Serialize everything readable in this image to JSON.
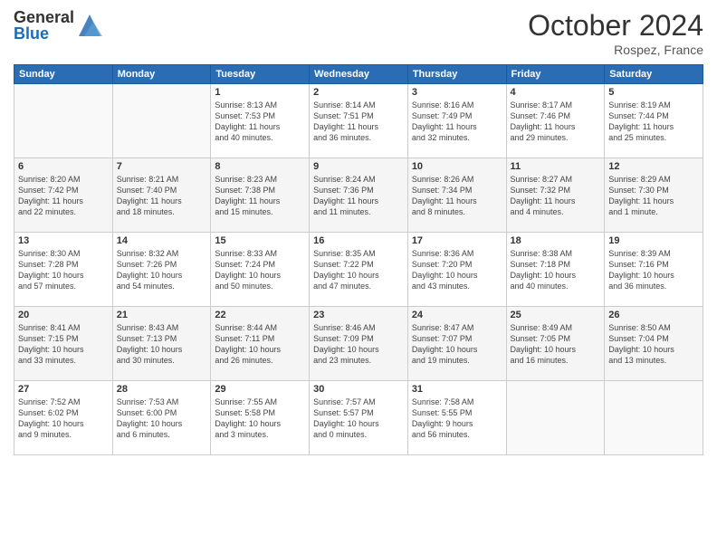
{
  "logo": {
    "general": "General",
    "blue": "Blue"
  },
  "title": "October 2024",
  "location": "Rospez, France",
  "days_header": [
    "Sunday",
    "Monday",
    "Tuesday",
    "Wednesday",
    "Thursday",
    "Friday",
    "Saturday"
  ],
  "weeks": [
    [
      {
        "day": "",
        "info": ""
      },
      {
        "day": "",
        "info": ""
      },
      {
        "day": "1",
        "info": "Sunrise: 8:13 AM\nSunset: 7:53 PM\nDaylight: 11 hours\nand 40 minutes."
      },
      {
        "day": "2",
        "info": "Sunrise: 8:14 AM\nSunset: 7:51 PM\nDaylight: 11 hours\nand 36 minutes."
      },
      {
        "day": "3",
        "info": "Sunrise: 8:16 AM\nSunset: 7:49 PM\nDaylight: 11 hours\nand 32 minutes."
      },
      {
        "day": "4",
        "info": "Sunrise: 8:17 AM\nSunset: 7:46 PM\nDaylight: 11 hours\nand 29 minutes."
      },
      {
        "day": "5",
        "info": "Sunrise: 8:19 AM\nSunset: 7:44 PM\nDaylight: 11 hours\nand 25 minutes."
      }
    ],
    [
      {
        "day": "6",
        "info": "Sunrise: 8:20 AM\nSunset: 7:42 PM\nDaylight: 11 hours\nand 22 minutes."
      },
      {
        "day": "7",
        "info": "Sunrise: 8:21 AM\nSunset: 7:40 PM\nDaylight: 11 hours\nand 18 minutes."
      },
      {
        "day": "8",
        "info": "Sunrise: 8:23 AM\nSunset: 7:38 PM\nDaylight: 11 hours\nand 15 minutes."
      },
      {
        "day": "9",
        "info": "Sunrise: 8:24 AM\nSunset: 7:36 PM\nDaylight: 11 hours\nand 11 minutes."
      },
      {
        "day": "10",
        "info": "Sunrise: 8:26 AM\nSunset: 7:34 PM\nDaylight: 11 hours\nand 8 minutes."
      },
      {
        "day": "11",
        "info": "Sunrise: 8:27 AM\nSunset: 7:32 PM\nDaylight: 11 hours\nand 4 minutes."
      },
      {
        "day": "12",
        "info": "Sunrise: 8:29 AM\nSunset: 7:30 PM\nDaylight: 11 hours\nand 1 minute."
      }
    ],
    [
      {
        "day": "13",
        "info": "Sunrise: 8:30 AM\nSunset: 7:28 PM\nDaylight: 10 hours\nand 57 minutes."
      },
      {
        "day": "14",
        "info": "Sunrise: 8:32 AM\nSunset: 7:26 PM\nDaylight: 10 hours\nand 54 minutes."
      },
      {
        "day": "15",
        "info": "Sunrise: 8:33 AM\nSunset: 7:24 PM\nDaylight: 10 hours\nand 50 minutes."
      },
      {
        "day": "16",
        "info": "Sunrise: 8:35 AM\nSunset: 7:22 PM\nDaylight: 10 hours\nand 47 minutes."
      },
      {
        "day": "17",
        "info": "Sunrise: 8:36 AM\nSunset: 7:20 PM\nDaylight: 10 hours\nand 43 minutes."
      },
      {
        "day": "18",
        "info": "Sunrise: 8:38 AM\nSunset: 7:18 PM\nDaylight: 10 hours\nand 40 minutes."
      },
      {
        "day": "19",
        "info": "Sunrise: 8:39 AM\nSunset: 7:16 PM\nDaylight: 10 hours\nand 36 minutes."
      }
    ],
    [
      {
        "day": "20",
        "info": "Sunrise: 8:41 AM\nSunset: 7:15 PM\nDaylight: 10 hours\nand 33 minutes."
      },
      {
        "day": "21",
        "info": "Sunrise: 8:43 AM\nSunset: 7:13 PM\nDaylight: 10 hours\nand 30 minutes."
      },
      {
        "day": "22",
        "info": "Sunrise: 8:44 AM\nSunset: 7:11 PM\nDaylight: 10 hours\nand 26 minutes."
      },
      {
        "day": "23",
        "info": "Sunrise: 8:46 AM\nSunset: 7:09 PM\nDaylight: 10 hours\nand 23 minutes."
      },
      {
        "day": "24",
        "info": "Sunrise: 8:47 AM\nSunset: 7:07 PM\nDaylight: 10 hours\nand 19 minutes."
      },
      {
        "day": "25",
        "info": "Sunrise: 8:49 AM\nSunset: 7:05 PM\nDaylight: 10 hours\nand 16 minutes."
      },
      {
        "day": "26",
        "info": "Sunrise: 8:50 AM\nSunset: 7:04 PM\nDaylight: 10 hours\nand 13 minutes."
      }
    ],
    [
      {
        "day": "27",
        "info": "Sunrise: 7:52 AM\nSunset: 6:02 PM\nDaylight: 10 hours\nand 9 minutes."
      },
      {
        "day": "28",
        "info": "Sunrise: 7:53 AM\nSunset: 6:00 PM\nDaylight: 10 hours\nand 6 minutes."
      },
      {
        "day": "29",
        "info": "Sunrise: 7:55 AM\nSunset: 5:58 PM\nDaylight: 10 hours\nand 3 minutes."
      },
      {
        "day": "30",
        "info": "Sunrise: 7:57 AM\nSunset: 5:57 PM\nDaylight: 10 hours\nand 0 minutes."
      },
      {
        "day": "31",
        "info": "Sunrise: 7:58 AM\nSunset: 5:55 PM\nDaylight: 9 hours\nand 56 minutes."
      },
      {
        "day": "",
        "info": ""
      },
      {
        "day": "",
        "info": ""
      }
    ]
  ]
}
